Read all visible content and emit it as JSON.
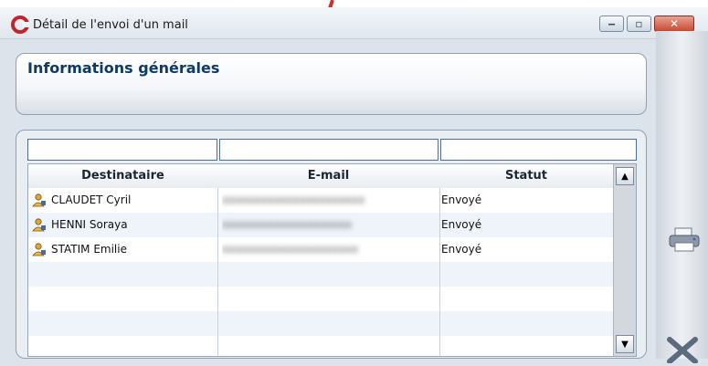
{
  "window": {
    "title": "Détail de l'envoi d'un mail"
  },
  "info_panel": {
    "title": "Informations générales"
  },
  "grid": {
    "columns": [
      "Destinataire",
      "E-mail",
      "Statut"
    ],
    "rows": [
      {
        "name": "CLAUDET Cyril",
        "email": "xxxxxxxxxxxxxxxxxxxxxx",
        "status": "Envoyé"
      },
      {
        "name": "HENNI Soraya",
        "email": "xxxxxxxxxxxxxxxxxxxx",
        "status": "Envoyé"
      },
      {
        "name": "STATIM Emilie",
        "email": "xxxxxxxxxxxxxxxxxxxxx",
        "status": "Envoyé"
      }
    ]
  },
  "colors": {
    "title_blue": "#0f3a66",
    "annotation_arrow": "#c0392b",
    "close_red": "#c64a32"
  }
}
